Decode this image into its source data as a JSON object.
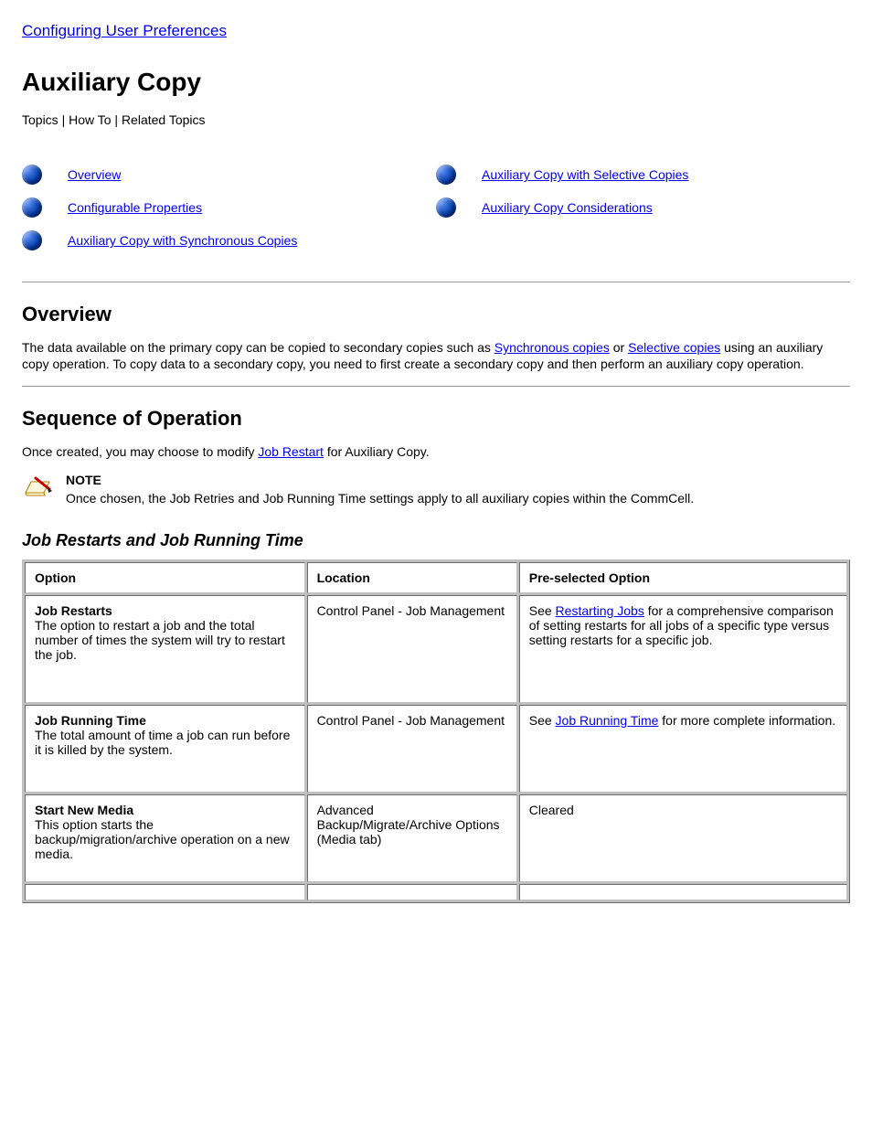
{
  "topLink": "Configuring User Preferences",
  "page": {
    "title": "Auxiliary Copy",
    "intro": "Topics | How To | Related Topics"
  },
  "topics": {
    "left": [
      {
        "label": "Overview"
      },
      {
        "label": "Configurable Properties"
      },
      {
        "label": "Auxiliary Copy with Synchronous Copies"
      }
    ],
    "right": [
      {
        "label": "Auxiliary Copy with Selective Copies"
      },
      {
        "label": "Auxiliary Copy Considerations"
      }
    ]
  },
  "overview": {
    "heading": "Overview",
    "p1": {
      "pre": "The data available on the primary copy can be copied to secondary copies such as ",
      "link1": "Synchronous copies",
      "mid": " or ",
      "link2": "Selective copies",
      "post": " using an auxiliary copy operation. To copy data to a secondary copy, you need to first create a secondary copy and then perform an auxiliary copy operation."
    }
  },
  "config": {
    "heading": "Sequence of Operation"
  },
  "seeAlso": {
    "pre": "Once created, you may choose to modify ",
    "link": "Job Restart",
    "post": " for Auxiliary Copy."
  },
  "note": {
    "label": "NOTE",
    "text": "Once chosen, the Job Retries and Job Running Time settings apply to all auxiliary copies within the CommCell."
  },
  "jobRestart": {
    "heading": "Job Restarts and Job Running Time",
    "table": {
      "headers": [
        "Option",
        "Location",
        "Pre-selected Option"
      ],
      "rows": [
        {
          "opt": "Job Restarts",
          "optDesc": "The option to restart a job and the total number of times the system will try to restart the job.",
          "loc": "Control Panel - Job Management",
          "refPre": "See ",
          "refLink": "Restarting Jobs",
          "refPost": " for a comprehensive comparison of setting restarts for all jobs of a specific type versus setting restarts for a specific job."
        },
        {
          "opt": "Job Running Time",
          "optDesc": "The total amount of time a job can run before it is killed by the system.",
          "loc": "Control Panel - Job Management",
          "refPre": "See ",
          "refLink": "Job Running Time",
          "refPost": " for more complete information."
        },
        {
          "opt": "Start New Media",
          "optDesc": "This option starts the backup/migration/archive operation on a new media.",
          "loc": "Advanced Backup/Migrate/Archive Options (Media tab)",
          "ref": "Cleared"
        }
      ]
    }
  }
}
